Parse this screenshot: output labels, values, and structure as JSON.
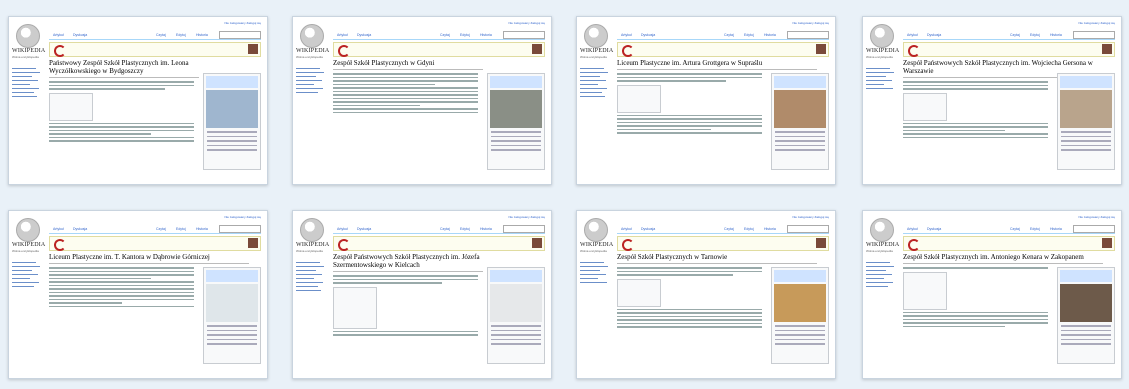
{
  "wiki": {
    "wordmark": "WIKIPEDIA",
    "tagline": "Wolna encyklopedia",
    "tab_article": "Artykuł",
    "tab_discussion": "Dyskusja",
    "tab_read": "Czytaj",
    "tab_edit": "Edytuj",
    "tab_history": "Historia",
    "toplinks": "Nie zalogowany  Zaloguj się"
  },
  "cards": [
    {
      "title": "Państwowy Zespół Szkół Plastycznych im. Leona Wyczółkowskiego w Bydgoszczy",
      "photo_color": "#9fb6cf"
    },
    {
      "title": "Zespół Szkół Plastycznych w Gdyni",
      "photo_color": "#8a8f86"
    },
    {
      "title": "Liceum Plastyczne im. Artura Grottgera w Supraślu",
      "photo_color": "#b08b6a"
    },
    {
      "title": "Zespół Państwowych Szkół Plastycznych im. Wojciecha Gersona w Warszawie",
      "photo_color": "#b9a48c"
    },
    {
      "title": "Liceum Plastyczne im. T. Kantora w Dąbrowie Górniczej",
      "photo_color": "#dfe6ea"
    },
    {
      "title": "Zespół Państwowych Szkół Plastycznych im. Józefa Szermentowskiego w Kielcach",
      "photo_color": "#e6e8ea"
    },
    {
      "title": "Zespół Szkół Plastycznych w Tarnowie",
      "photo_color": "#c79a5a"
    },
    {
      "title": "Zespół Szkół Plastycznych im. Antoniego Kenara w Zakopanem",
      "photo_color": "#6d5a4a"
    }
  ]
}
